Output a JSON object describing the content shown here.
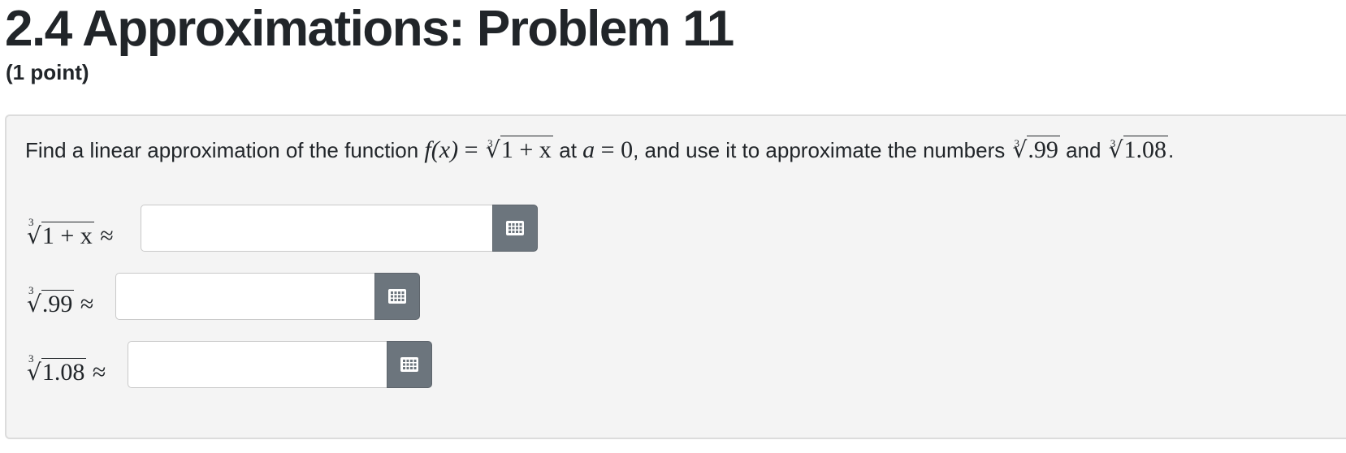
{
  "header": {
    "title": "2.4 Approximations: Problem 11",
    "points": "(1 point)"
  },
  "problem": {
    "text_before_function": "Find a linear approximation of the function",
    "function_lhs": "f(x)",
    "function_radicand": "1 + x",
    "text_at": "at",
    "point_var": "a",
    "point_value": "0",
    "text_middle": ", and use it to approximate the numbers",
    "number_1": ".99",
    "text_and": "and",
    "number_2": "1.08",
    "text_end": ".",
    "root_index": "3"
  },
  "answers": [
    {
      "radicand": "1 + x",
      "approx_symbol": "≈",
      "value": ""
    },
    {
      "radicand": ".99",
      "approx_symbol": "≈",
      "value": ""
    },
    {
      "radicand": "1.08",
      "approx_symbol": "≈",
      "value": ""
    }
  ],
  "icons": {
    "keypad": "keypad-icon"
  },
  "colors": {
    "keypad_button": "#6c757d",
    "panel_background": "#f4f4f4"
  }
}
